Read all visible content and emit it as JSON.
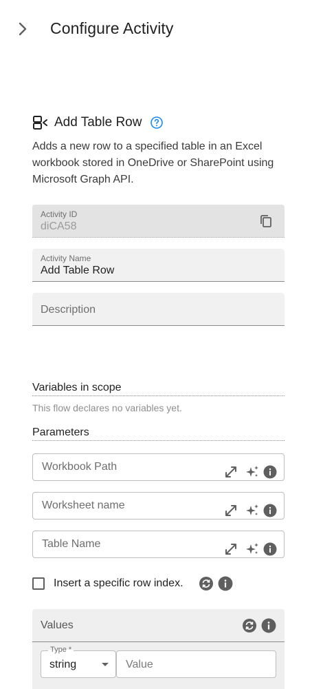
{
  "header": {
    "title": "Configure Activity"
  },
  "activity": {
    "title": "Add Table Row",
    "description": "Adds a new row to a specified table in an Excel workbook stored in OneDrive or SharePoint using Microsoft Graph API."
  },
  "fields": {
    "activity_id": {
      "label": "Activity ID",
      "value": "diCA58"
    },
    "activity_name": {
      "label": "Activity Name",
      "value": "Add Table Row"
    },
    "description": {
      "placeholder": "Description"
    }
  },
  "variables": {
    "title": "Variables in scope",
    "note": "This flow declares no variables yet."
  },
  "parameters": {
    "title": "Parameters",
    "workbook_path": {
      "placeholder": "Workbook Path"
    },
    "worksheet_name": {
      "placeholder": "Worksheet name"
    },
    "table_name": {
      "placeholder": "Table Name"
    }
  },
  "row_index": {
    "label": "Insert a specific row index.",
    "checked": false
  },
  "values": {
    "title": "Values",
    "type_label": "Type *",
    "type_value": "string",
    "value_placeholder": "Value"
  },
  "colors": {
    "help_accent": "#1e88e5",
    "icon_dark": "#5f5f5f",
    "field_bg": "#f1f1f1"
  },
  "icons": [
    "chevron-right-icon",
    "table-row-add-icon",
    "help-icon",
    "copy-icon",
    "expand-icon",
    "magic-sparkle-icon",
    "info-icon",
    "sync-icon"
  ]
}
